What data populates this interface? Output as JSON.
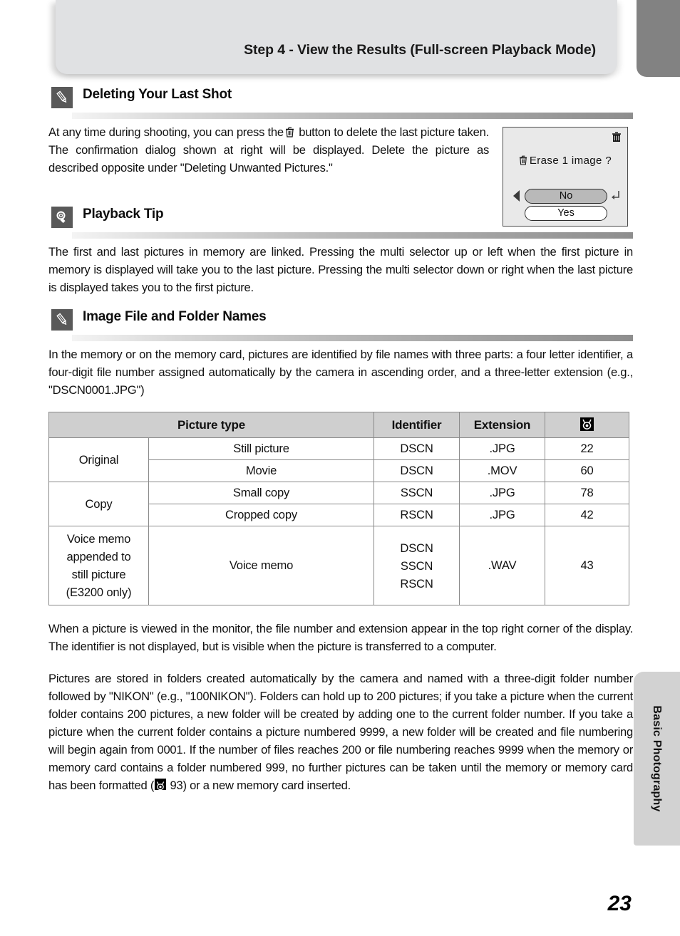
{
  "header": {
    "title": "Step 4 - View the Results (Full-screen Playback Mode)"
  },
  "sections": [
    {
      "icon": "pencil-icon",
      "title": "Deleting Your Last Shot",
      "paragraph": "At any time during shooting, you can press the   button to delete the last picture taken. The confirmation dialog shown at right will be displayed. Delete the picture as described opposite under \"Deleting Unwanted Pictures.\""
    },
    {
      "icon": "lightbulb-icon",
      "title": "Playback Tip",
      "paragraph": "The first and last pictures in memory are linked. Pressing the multi selector up or left when the first picture in memory is displayed will take you to the last picture. Pressing the multi selector down or right when the last picture is displayed takes you to the first picture."
    },
    {
      "icon": "pencil-icon",
      "title": "Image File and Folder Names",
      "paragraph": "In the memory or on the memory card, pictures are identified by file names with three parts: a four letter identifier, a four-digit file number assigned automatically by the camera in ascending order, and a three-letter extension (e.g., \"DSCN0001.JPG\")"
    }
  ],
  "body_text": {
    "delete_part1": "At any time during shooting, you can press the",
    "delete_part2": "button to delete the last picture taken. The confirmation dialog shown at right will be displayed. Delete the picture as described opposite under \"Deleting Unwanted Pictures.\"",
    "after_table": "When a picture is viewed in the monitor, the file number and extension appear in the top right corner of the display. The identifier is not displayed, but is visible when the picture is transferred to a computer.",
    "folders_part1": "Pictures are stored in folders created automatically by the camera and named with a three-digit folder number followed by \"NIKON\" (e.g., \"100NIKON\"). Folders can hold up to 200 pictures; if you take a picture when the current folder contains 200 pictures, a new folder will be created by adding one to the current folder number. If you take a picture when the current folder contains a picture numbered 9999, a new folder will be created and file numbering will begin again from 0001. If the number of files reaches 200 or file numbering reaches 9999 when the memory or memory card contains a folder numbered 999, no further pictures can be taken until the memory or memory card has been formatted (",
    "folders_ref_page": "93",
    "folders_part2": ") or a new memory card inserted."
  },
  "lcd_dialog": {
    "top_icon": "trash-icon",
    "message": "Erase 1 image ?",
    "message_icon": "trash-icon",
    "button_selected": "No",
    "button_unselected": "Yes"
  },
  "table": {
    "headers": [
      "Picture type",
      "Identifier",
      "Extension",
      "reference-icon"
    ],
    "rows": [
      {
        "group": "Original",
        "group_rowspan": 2,
        "type": "Still picture",
        "identifier": "DSCN",
        "extension": ".JPG",
        "page": "22"
      },
      {
        "group": null,
        "type": "Movie",
        "identifier": "DSCN",
        "extension": ".MOV",
        "page": "60"
      },
      {
        "group": "Copy",
        "group_rowspan": 2,
        "type": "Small copy",
        "identifier": "SSCN",
        "extension": ".JPG",
        "page": "78"
      },
      {
        "group": null,
        "type": "Cropped copy",
        "identifier": "RSCN",
        "extension": ".JPG",
        "page": "42"
      },
      {
        "group": "Voice memo appended to still picture (E3200 only)",
        "group_rowspan": 1,
        "type": "Voice memo",
        "identifier": "DSCN\nSSCN\nRSCN",
        "extension": ".WAV",
        "page": "43"
      }
    ],
    "group_labels": {
      "original": "Original",
      "copy": "Copy",
      "voice_memo_line1": "Voice memo",
      "voice_memo_line2": "appended to",
      "voice_memo_line3": "still picture",
      "voice_memo_line4": "(E3200 only)"
    },
    "voice_identifiers": [
      "DSCN",
      "SSCN",
      "RSCN"
    ]
  },
  "side_tab": {
    "label": "Basic Photography"
  },
  "page_number": "23",
  "colors": {
    "banner": "#e0e1e3",
    "corner_tab": "#828282",
    "side_tab": "#d2d2d2",
    "icon_box": "#595959",
    "table_header": "#cfcfcf"
  }
}
